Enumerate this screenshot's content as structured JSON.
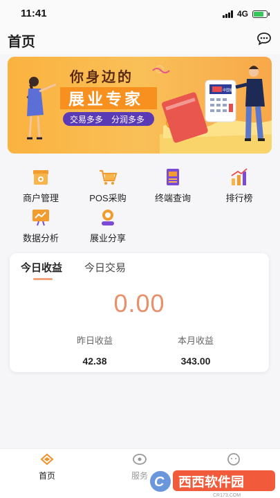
{
  "status_bar": {
    "time": "11:41",
    "network": "4G",
    "battery_level": 0.8
  },
  "header": {
    "title": "首页",
    "action_icon": "chat-bubble-icon"
  },
  "banner": {
    "headline_line1": "你身边的",
    "headline_line2": "展业专家",
    "tagline_left": "交易多多",
    "tagline_right": "分润多多",
    "terminal_brand": "中国银联"
  },
  "menu": [
    {
      "label": "商户管理",
      "icon": "shop-icon"
    },
    {
      "label": "POS采购",
      "icon": "cart-icon"
    },
    {
      "label": "终端查询",
      "icon": "terminal-icon"
    },
    {
      "label": "排行榜",
      "icon": "ranking-icon"
    },
    {
      "label": "数据分析",
      "icon": "analytics-icon"
    },
    {
      "label": "展业分享",
      "icon": "share-icon"
    }
  ],
  "earnings": {
    "tabs": [
      "今日收益",
      "今日交易"
    ],
    "active_tab": 0,
    "today_value": "0.00",
    "yesterday_label": "昨日收益",
    "yesterday_value": "42.38",
    "month_label": "本月收益",
    "month_value": "343.00"
  },
  "bottom_nav": [
    {
      "label": "首页",
      "icon": "home-icon",
      "active": true
    },
    {
      "label": "服务",
      "icon": "service-icon",
      "active": false
    },
    {
      "label": "",
      "icon": "profile-icon",
      "active": false
    }
  ],
  "watermark": {
    "text": "西西软件园",
    "url_text": "CR173.COM"
  },
  "colors": {
    "accent": "#f5a623",
    "value": "#e8906a",
    "nav_active": "#f0902a"
  }
}
